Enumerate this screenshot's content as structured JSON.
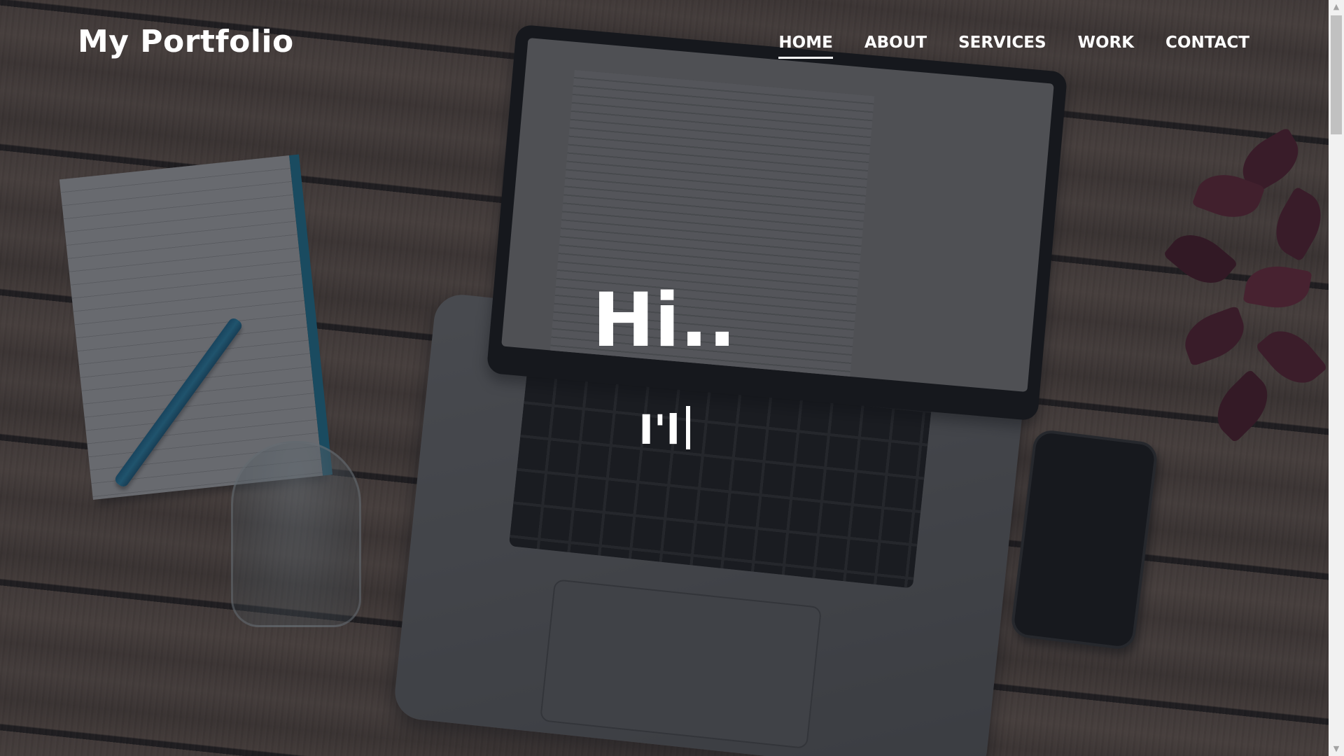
{
  "header": {
    "logo": "My Portfolio",
    "nav": [
      {
        "label": "HOME",
        "active": true
      },
      {
        "label": "ABOUT",
        "active": false
      },
      {
        "label": "SERVICES",
        "active": false
      },
      {
        "label": "WORK",
        "active": false
      },
      {
        "label": "CONTACT",
        "active": false
      }
    ]
  },
  "hero": {
    "title": "Hi..",
    "typed_text": "I'l"
  },
  "scrollbar": {
    "up_icon": "▲",
    "down_icon": "▼"
  },
  "colors": {
    "text": "#ffffff",
    "overlay": "#161a22",
    "scrollbar_track": "#f1f1f1",
    "scrollbar_thumb": "#c1c1c1"
  }
}
